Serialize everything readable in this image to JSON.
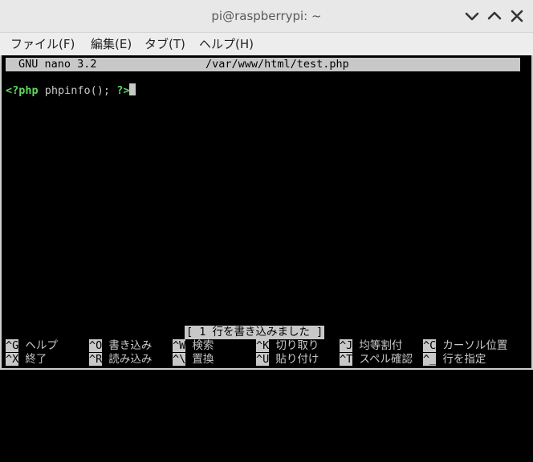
{
  "window": {
    "title": "pi@raspberrypi: ~"
  },
  "menu": [
    {
      "label": "ファイル(F)"
    },
    {
      "label": "編集(E)"
    },
    {
      "label": "タブ(T)"
    },
    {
      "label": "ヘルプ(H)"
    }
  ],
  "nano": {
    "version": "GNU nano 3.2",
    "filename": "/var/www/html/test.php",
    "code": {
      "open_tag": "<?php",
      "body": " phpinfo(); ",
      "close_tag": "?>"
    },
    "status_message": "[ 1 行を書き込みました ]",
    "shortcuts_row1": [
      {
        "key": "^G",
        "label": "ヘルプ"
      },
      {
        "key": "^O",
        "label": "書き込み"
      },
      {
        "key": "^W",
        "label": "検索"
      },
      {
        "key": "^K",
        "label": "切り取り"
      },
      {
        "key": "^J",
        "label": "均等割付"
      },
      {
        "key": "^C",
        "label": "カーソル位置"
      }
    ],
    "shortcuts_row2": [
      {
        "key": "^X",
        "label": "終了"
      },
      {
        "key": "^R",
        "label": "読み込み"
      },
      {
        "key": "^\\",
        "label": "置換"
      },
      {
        "key": "^U",
        "label": "貼り付け"
      },
      {
        "key": "^T",
        "label": "スペル確認"
      },
      {
        "key": "^_",
        "label": "行を指定"
      }
    ]
  },
  "colors": {
    "titlebar_bg": "#e8e8e8",
    "terminal_bg": "#000000",
    "terminal_fg": "#c8c8c8",
    "php_tag": "#5fd75f"
  }
}
